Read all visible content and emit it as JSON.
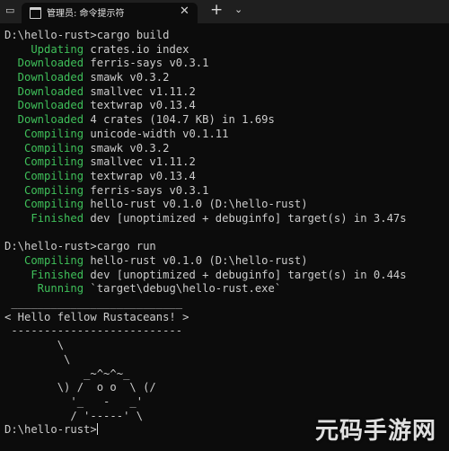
{
  "window": {
    "tab_title": "管理员: 命令提示符",
    "tab_close": "✕",
    "new_tab": "+",
    "dropdown": "⌄"
  },
  "terminal": {
    "prompt1": "D:\\hello-rust>cargo build",
    "build": [
      {
        "status": "    Updating",
        "msg": " crates.io index"
      },
      {
        "status": "  Downloaded",
        "msg": " ferris-says v0.3.1"
      },
      {
        "status": "  Downloaded",
        "msg": " smawk v0.3.2"
      },
      {
        "status": "  Downloaded",
        "msg": " smallvec v1.11.2"
      },
      {
        "status": "  Downloaded",
        "msg": " textwrap v0.13.4"
      },
      {
        "status": "  Downloaded",
        "msg": " 4 crates (104.7 KB) in 1.69s"
      },
      {
        "status": "   Compiling",
        "msg": " unicode-width v0.1.11"
      },
      {
        "status": "   Compiling",
        "msg": " smawk v0.3.2"
      },
      {
        "status": "   Compiling",
        "msg": " smallvec v1.11.2"
      },
      {
        "status": "   Compiling",
        "msg": " textwrap v0.13.4"
      },
      {
        "status": "   Compiling",
        "msg": " ferris-says v0.3.1"
      },
      {
        "status": "   Compiling",
        "msg": " hello-rust v0.1.0 (D:\\hello-rust)"
      },
      {
        "status": "    Finished",
        "msg": " dev [unoptimized + debuginfo] target(s) in 3.47s"
      }
    ],
    "prompt2": "D:\\hello-rust>cargo run",
    "run": [
      {
        "status": "   Compiling",
        "msg": " hello-rust v0.1.0 (D:\\hello-rust)"
      },
      {
        "status": "    Finished",
        "msg": " dev [unoptimized + debuginfo] target(s) in 0.44s"
      },
      {
        "status": "     Running",
        "msg": " `target\\debug\\hello-rust.exe`"
      }
    ],
    "ferris": [
      " __________________________",
      "< Hello fellow Rustaceans! >",
      " --------------------------",
      "        \\",
      "         \\",
      "            _~^~^~_",
      "        \\) /  o o  \\ (/",
      "          '_   -   _'",
      "          / '-----' \\"
    ],
    "prompt3": "D:\\hello-rust>"
  },
  "colors": {
    "status_green": "#3fc05a",
    "background": "#0c0c0c",
    "text": "#cccccc"
  },
  "watermark": "元码手游网"
}
